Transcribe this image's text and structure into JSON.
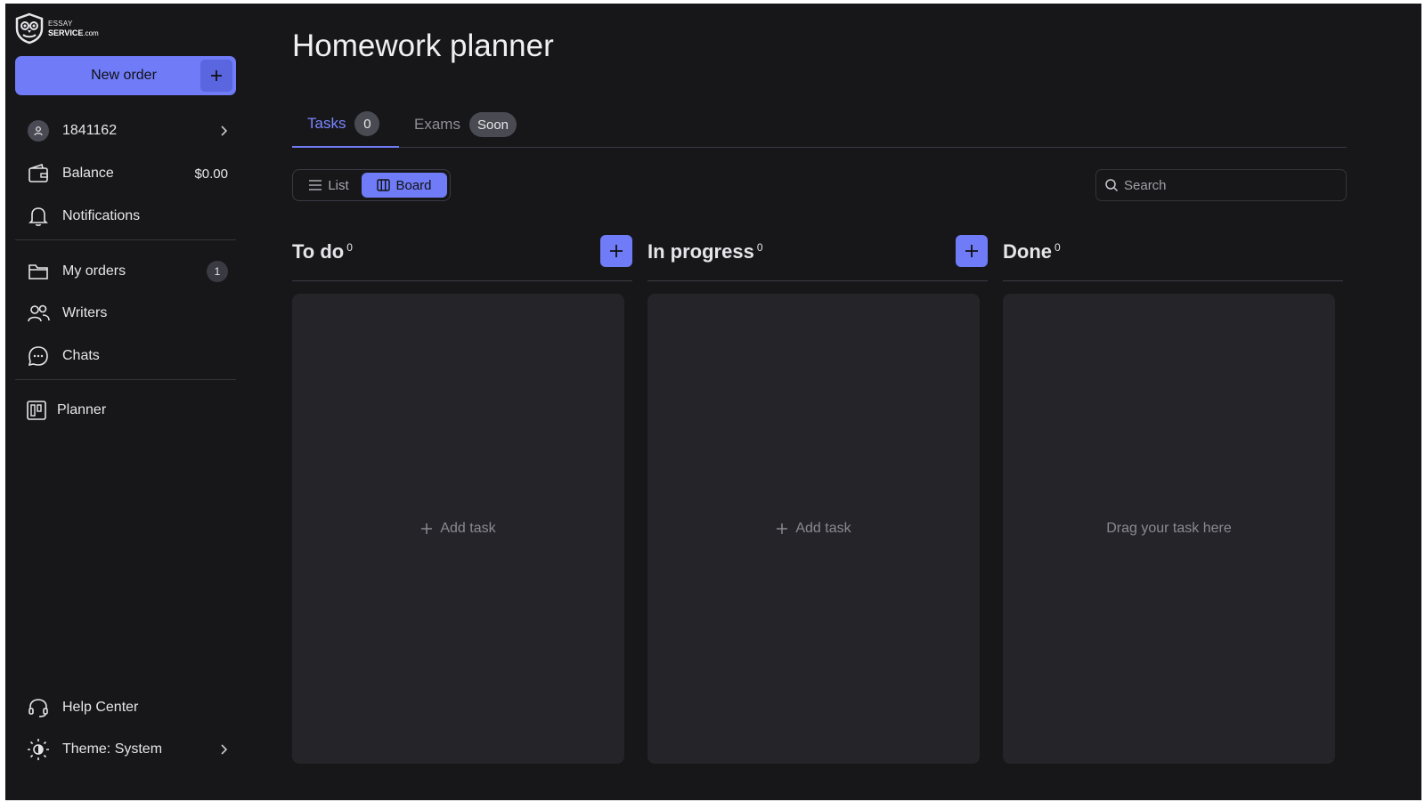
{
  "brand": {
    "line1": "ESSAY",
    "line2": "SERVICE",
    "line2_suffix": ".com"
  },
  "sidebar": {
    "new_order": "New order",
    "user_id": "1841162",
    "balance_label": "Balance",
    "balance_value": "$0.00",
    "notifications": "Notifications",
    "my_orders": "My orders",
    "my_orders_count": "1",
    "writers": "Writers",
    "chats": "Chats",
    "planner": "Planner",
    "help_center": "Help Center",
    "theme": "Theme: System"
  },
  "main": {
    "title": "Homework planner",
    "tabs": [
      {
        "label": "Tasks",
        "badge": "0",
        "active": true
      },
      {
        "label": "Exams",
        "badge": "Soon",
        "active": false
      }
    ],
    "view_toggle": {
      "list": "List",
      "board": "Board",
      "selected": "Board"
    },
    "search": {
      "placeholder": "Search",
      "value": ""
    },
    "columns": [
      {
        "title": "To do",
        "count": "0",
        "body": "Add task"
      },
      {
        "title": "In progress",
        "count": "0",
        "body": "Add task"
      },
      {
        "title": "Done",
        "count": "0",
        "body": "Drag your task here"
      }
    ]
  },
  "colors": {
    "accent": "#6f7bf7",
    "background": "#17171a",
    "panel": "#242429"
  }
}
